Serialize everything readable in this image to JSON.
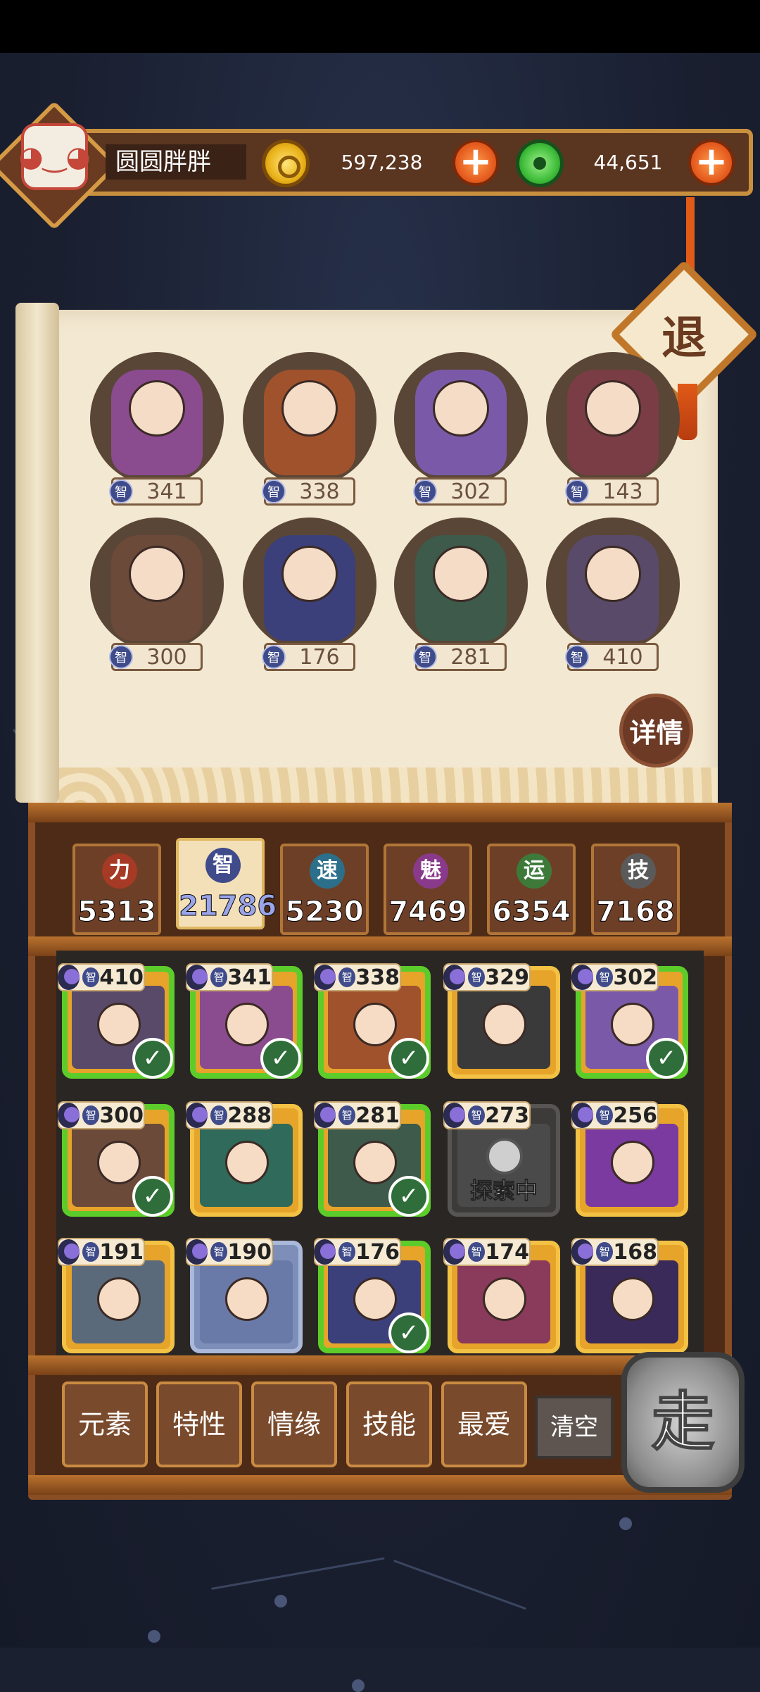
{
  "player": {
    "name": "圆圆胖胖"
  },
  "currencies": {
    "gold": "597,238",
    "jade": "44,651"
  },
  "header_buttons": {
    "retreat": "退",
    "details": "详情"
  },
  "team": [
    {
      "stat_label": "智",
      "value": "341",
      "color": "#8a4b8f"
    },
    {
      "stat_label": "智",
      "value": "338",
      "color": "#a0522d"
    },
    {
      "stat_label": "智",
      "value": "302",
      "color": "#7a5aa8"
    },
    {
      "stat_label": "智",
      "value": "143",
      "color": "#7a3d45"
    },
    {
      "stat_label": "智",
      "value": "300",
      "color": "#6b4a3a"
    },
    {
      "stat_label": "智",
      "value": "176",
      "color": "#3b3f7a"
    },
    {
      "stat_label": "智",
      "value": "281",
      "color": "#3d5a4a"
    },
    {
      "stat_label": "智",
      "value": "410",
      "color": "#5a4a6a"
    }
  ],
  "attributes": [
    {
      "label": "力",
      "value": "5313",
      "color": "#a63a24",
      "active": false
    },
    {
      "label": "智",
      "value": "21786",
      "color": "#3f4b8a",
      "active": true
    },
    {
      "label": "速",
      "value": "5230",
      "color": "#2c6f8a",
      "active": false
    },
    {
      "label": "魅",
      "value": "7469",
      "color": "#8a3a8a",
      "active": false
    },
    {
      "label": "运",
      "value": "6354",
      "color": "#3d7a3a",
      "active": false
    },
    {
      "label": "技",
      "value": "7168",
      "color": "#5a5a5a",
      "active": false
    }
  ],
  "roster": [
    {
      "stat": "智",
      "value": "410",
      "selected": true
    },
    {
      "stat": "智",
      "value": "341",
      "selected": true
    },
    {
      "stat": "智",
      "value": "338",
      "selected": true
    },
    {
      "stat": "智",
      "value": "329",
      "selected": false
    },
    {
      "stat": "智",
      "value": "302",
      "selected": true
    },
    {
      "stat": "智",
      "value": "300",
      "selected": true
    },
    {
      "stat": "智",
      "value": "288",
      "selected": false
    },
    {
      "stat": "智",
      "value": "281",
      "selected": true
    },
    {
      "stat": "智",
      "value": "273",
      "selected": false,
      "status": "探索中"
    },
    {
      "stat": "智",
      "value": "256",
      "selected": false
    },
    {
      "stat": "智",
      "value": "191",
      "selected": false
    },
    {
      "stat": "智",
      "value": "190",
      "selected": false
    },
    {
      "stat": "智",
      "value": "176",
      "selected": true
    },
    {
      "stat": "智",
      "value": "174",
      "selected": false
    },
    {
      "stat": "智",
      "value": "168",
      "selected": false
    }
  ],
  "filters": [
    "元素",
    "特性",
    "情缘",
    "技能",
    "最爱"
  ],
  "clear_label": "清空",
  "go_label": "走",
  "check_mark": "✓"
}
